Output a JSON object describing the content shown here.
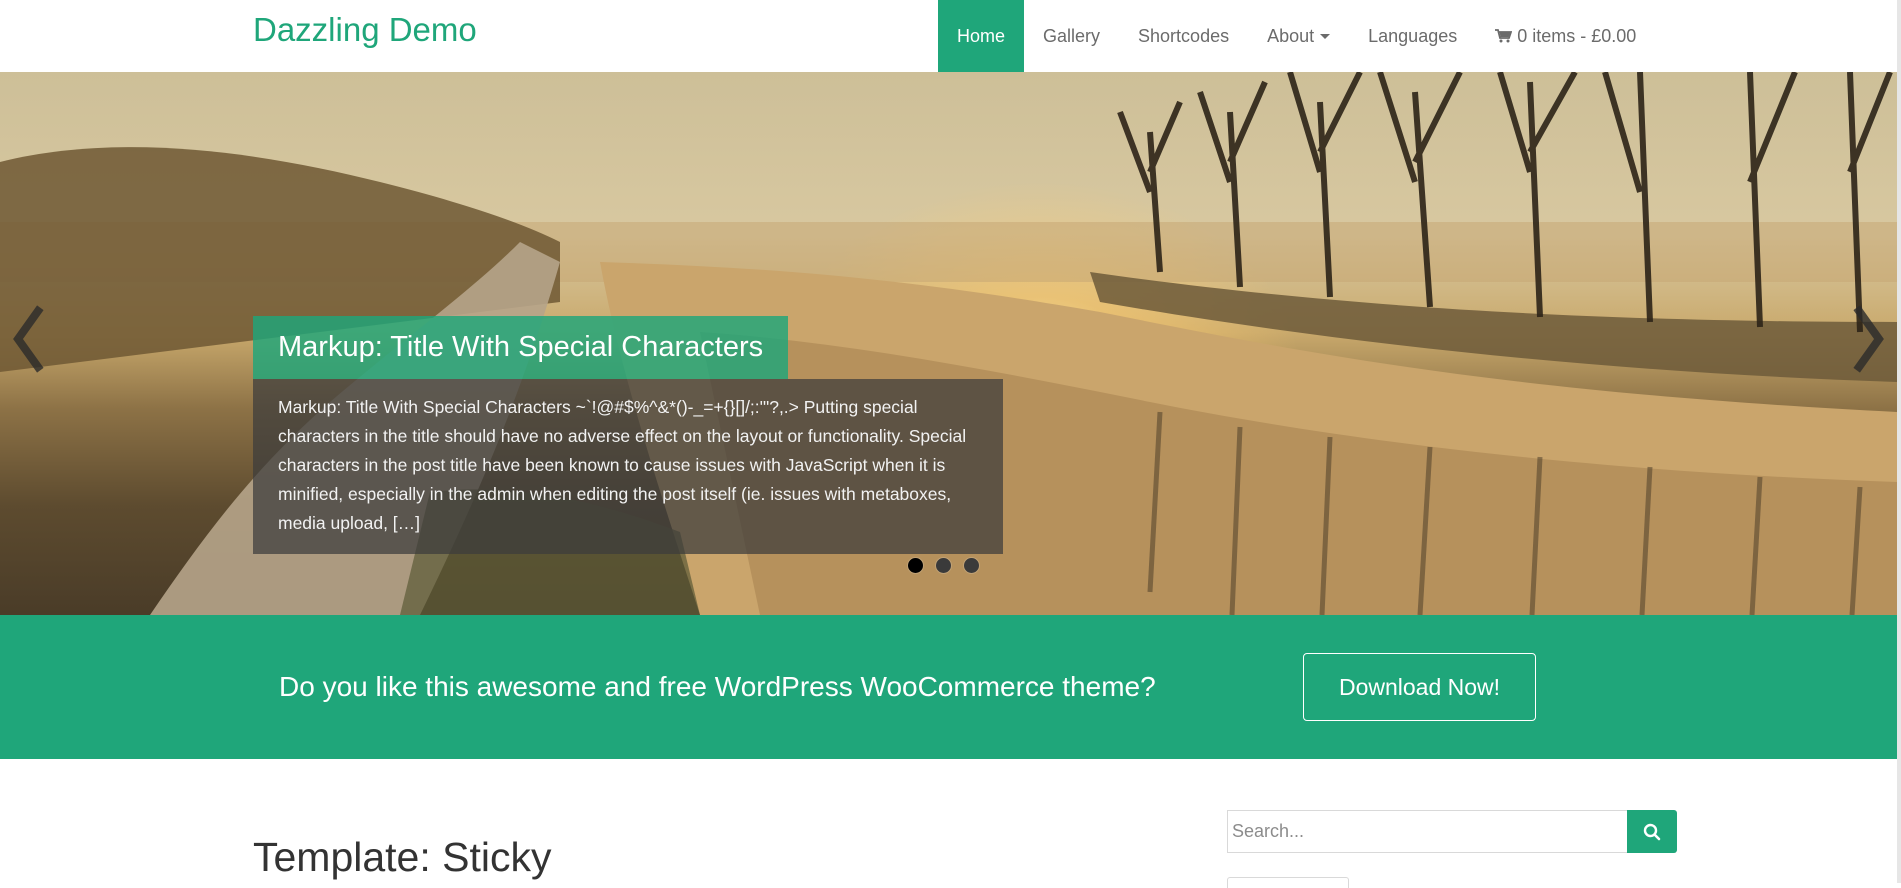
{
  "site": {
    "title": "Dazzling Demo"
  },
  "nav": {
    "items": [
      {
        "label": "Home"
      },
      {
        "label": "Gallery"
      },
      {
        "label": "Shortcodes"
      },
      {
        "label": "About"
      },
      {
        "label": "Languages"
      },
      {
        "label": "0 items - £0.00"
      }
    ],
    "active_index": 0
  },
  "slider": {
    "caption_title": "Markup: Title With Special Characters",
    "caption_excerpt": "Markup: Title With Special Characters ~`!@#$%^&*()-_=+{}[]/;:'\"?,.> Putting special characters in the title should have no adverse effect on the layout or functionality. Special characters in the post title have been known to cause issues with JavaScript when it is minified, especially in the admin when editing the post itself (ie. issues with metaboxes, media upload, […]",
    "slide_count": 3,
    "active_slide": 1
  },
  "cta": {
    "text": "Do you like this awesome and free WordPress WooCommerce theme?",
    "button_label": "Download Now!"
  },
  "post": {
    "title": "Template: Sticky"
  },
  "sidebar": {
    "search_placeholder": "Search..."
  },
  "colors": {
    "accent": "#1fa67a",
    "nav_text": "#6b6b6b",
    "body_text": "#333333"
  },
  "icons": {
    "cart": "shopping-cart-icon",
    "search": "search-icon",
    "prev": "chevron-left-icon",
    "next": "chevron-right-icon"
  }
}
